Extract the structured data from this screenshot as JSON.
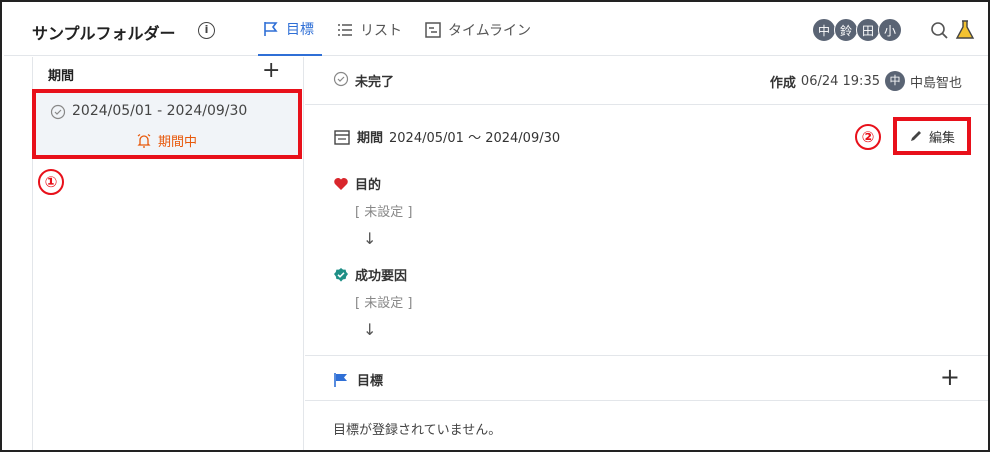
{
  "header": {
    "folder_title": "サンプルフォルダー",
    "info_glyph": "i",
    "tabs": [
      {
        "label": "目標",
        "icon": "flag-icon",
        "active": true
      },
      {
        "label": "リスト",
        "icon": "list-icon",
        "active": false
      },
      {
        "label": "タイムライン",
        "icon": "timeline-icon",
        "active": false
      }
    ],
    "avatars": [
      "中",
      "鈴",
      "田",
      "小"
    ]
  },
  "sidebar": {
    "title": "期間",
    "add_glyph": "+",
    "period": {
      "range": "2024/05/01 - 2024/09/30",
      "status": "期間中"
    }
  },
  "main": {
    "status": "未完了",
    "created_label": "作成",
    "created_at": "06/24 19:35",
    "creator_avatar": "中",
    "creator_name": "中島智也",
    "period_label": "期間",
    "period_range": "2024/05/01 〜 2024/09/30",
    "edit_label": "編集",
    "purpose_label": "目的",
    "purpose_value": "[ 未設定 ]",
    "success_label": "成功要因",
    "success_value": "[ 未設定 ]",
    "arrow_glyph": "↓",
    "goals_label": "目標",
    "goals_add_glyph": "+",
    "goals_empty": "目標が登録されていません。"
  },
  "callouts": [
    "①",
    "②"
  ],
  "colors": {
    "accent": "#2f6fd6",
    "highlight": "#e8101a",
    "status_orange": "#e8590c",
    "heart": "#d9262c",
    "badge_teal": "#1f8f86"
  }
}
